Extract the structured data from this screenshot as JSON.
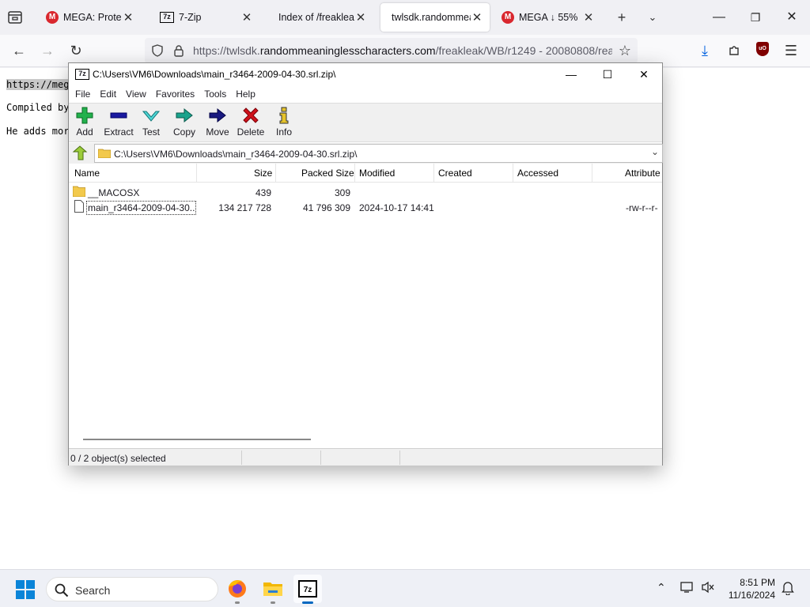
{
  "browser": {
    "tabs": [
      {
        "title": "MEGA: Protect y",
        "favicon": "mega-icon"
      },
      {
        "title": "7-Zip",
        "favicon": "7zip-icon"
      },
      {
        "title": "Index of /freakleak/W",
        "favicon": "none"
      },
      {
        "title": "twlsdk.randommean",
        "favicon": "none",
        "active": true
      },
      {
        "title": "MEGA ↓ 55%",
        "favicon": "mega-icon"
      }
    ],
    "url_prefix": "https://twlsdk.",
    "url_domain": "randommeaninglesscharacters.com",
    "url_path": "/freakleak/WB/r1249 - 20080808/rea"
  },
  "page": {
    "lines": [
      "https://meg",
      "Compiled by",
      "He adds mor"
    ]
  },
  "zip_window": {
    "title": "C:\\Users\\VM6\\Downloads\\main_r3464-2009-04-30.srl.zip\\",
    "menu": [
      "File",
      "Edit",
      "View",
      "Favorites",
      "Tools",
      "Help"
    ],
    "toolbar": {
      "add": "Add",
      "extract": "Extract",
      "test": "Test",
      "copy": "Copy",
      "move": "Move",
      "delete": "Delete",
      "info": "Info"
    },
    "address": "C:\\Users\\VM6\\Downloads\\main_r3464-2009-04-30.srl.zip\\",
    "columns": {
      "name": "Name",
      "size": "Size",
      "packed": "Packed Size",
      "modified": "Modified",
      "created": "Created",
      "accessed": "Accessed",
      "attributes": "Attribute"
    },
    "rows": [
      {
        "name": "__MACOSX",
        "size": "439",
        "packed": "309",
        "modified": "",
        "attributes": "",
        "type": "folder"
      },
      {
        "name": "main_r3464-2009-04-30....",
        "size": "134 217 728",
        "packed": "41 796 309",
        "modified": "2024-10-17 14:41",
        "attributes": "-rw-r--r-",
        "type": "file"
      }
    ],
    "status": "0 / 2 object(s) selected"
  },
  "taskbar": {
    "search_placeholder": "Search",
    "time": "8:51 PM",
    "date": "11/16/2024"
  },
  "colors": {
    "accent": "#0067c0",
    "mega_red": "#d9272e",
    "add_green": "#22b14c",
    "extract_blue": "#1a1aa0",
    "delete_red": "#d0121b"
  }
}
